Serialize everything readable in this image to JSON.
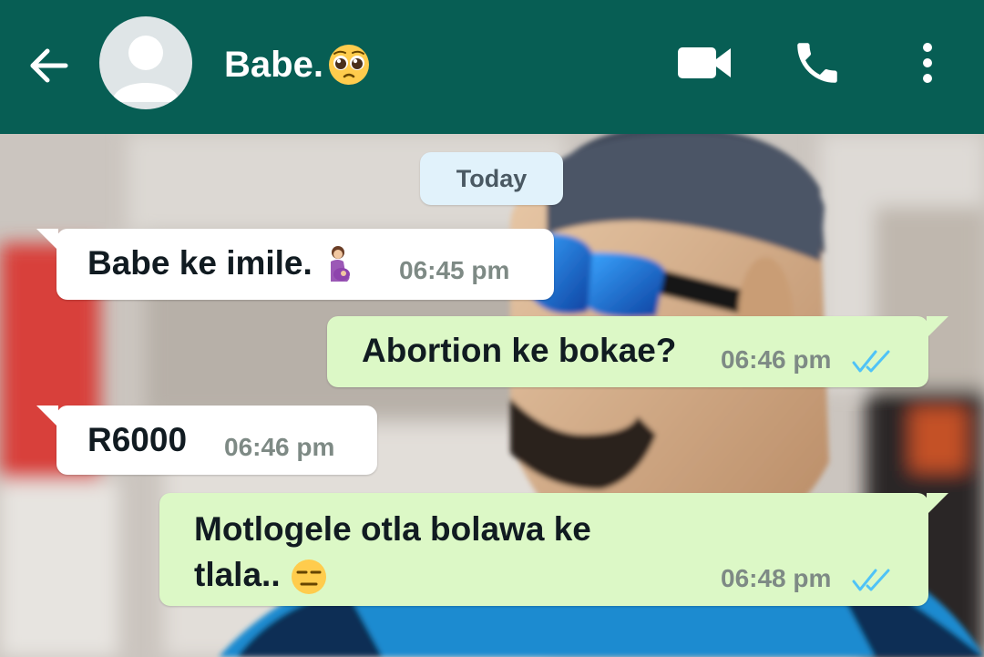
{
  "header": {
    "contact_name": "Babe.",
    "title_emoji": "pleading-face-emoji",
    "icons": [
      "back-arrow-icon",
      "avatar-placeholder-icon",
      "video-call-icon",
      "phone-call-icon",
      "more-options-icon"
    ],
    "bg_color": "#075e54"
  },
  "chat": {
    "date_chip": "Today",
    "messages": [
      {
        "direction": "incoming",
        "text": "Babe ke imile.",
        "emoji": "pregnant-woman-emoji",
        "time": "06:45 pm"
      },
      {
        "direction": "outgoing",
        "text": "Abortion ke bokae?",
        "time": "06:46 pm",
        "status": "read"
      },
      {
        "direction": "incoming",
        "text": "R6000",
        "time": "06:46 pm"
      },
      {
        "direction": "outgoing",
        "text_line1": "Motlogele otla bolawa ke",
        "text_line2": "tlala..",
        "emoji": "expressionless-face-emoji",
        "time": "06:48 pm",
        "status": "read"
      }
    ],
    "colors": {
      "incoming_bubble": "#ffffff",
      "outgoing_bubble": "#dcf8c6",
      "read_ticks": "#4fc3f7",
      "date_chip_bg": "#e1f2fb"
    }
  }
}
